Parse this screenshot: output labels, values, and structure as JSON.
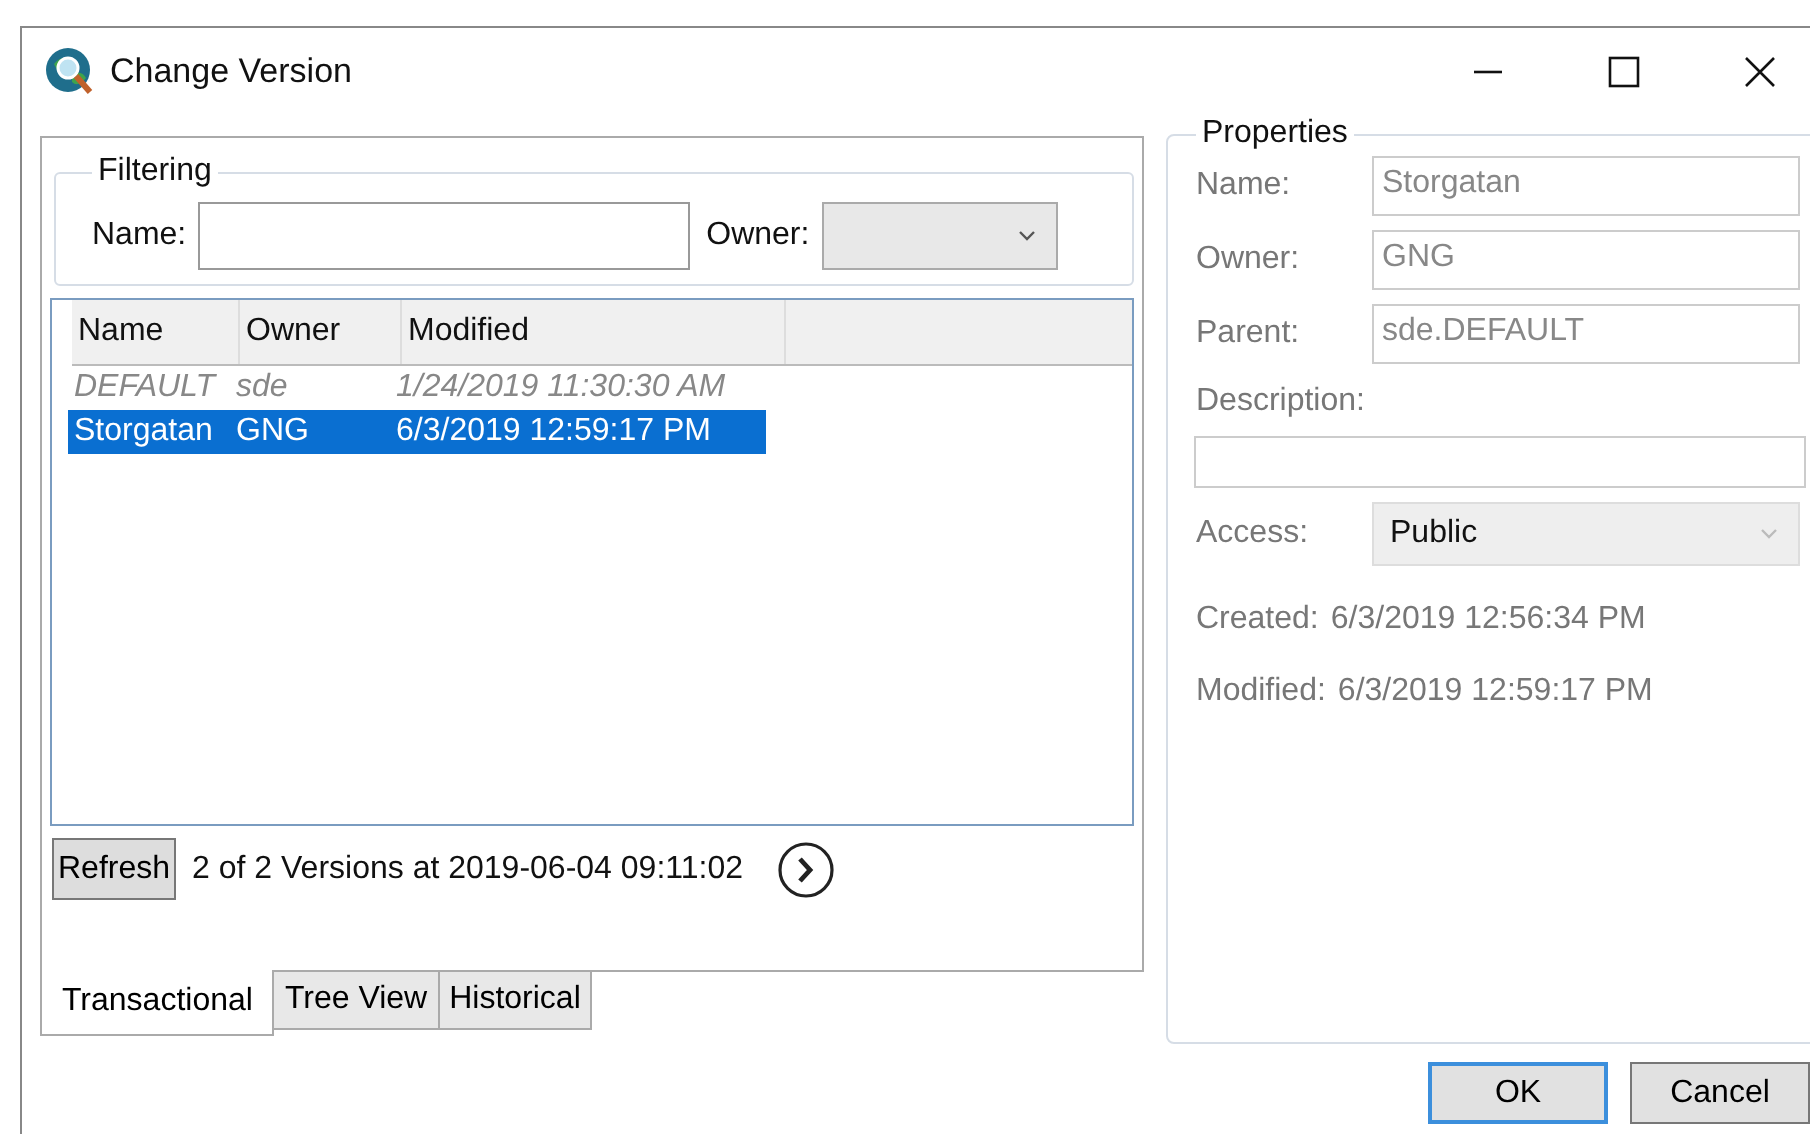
{
  "window": {
    "title": "Change Version"
  },
  "filtering": {
    "legend": "Filtering",
    "name_label": "Name:",
    "owner_label": "Owner:"
  },
  "table": {
    "columns": [
      "Name",
      "Owner",
      "Modified"
    ],
    "rows": [
      {
        "cells": [
          "DEFAULT",
          "sde",
          "1/24/2019 11:30:30 AM"
        ],
        "disabled": true,
        "selected": false
      },
      {
        "cells": [
          "Storgatan",
          "GNG",
          "6/3/2019 12:59:17 PM"
        ],
        "disabled": false,
        "selected": true
      }
    ]
  },
  "refresh_button": "Refresh",
  "status": "2 of 2 Versions at 2019-06-04 09:11:02",
  "tabs": [
    {
      "label": "Transactional",
      "selected": true
    },
    {
      "label": "Tree View",
      "selected": false
    },
    {
      "label": "Historical",
      "selected": false
    }
  ],
  "properties": {
    "legend": "Properties",
    "fields": [
      {
        "label": "Name:",
        "value": "Storgatan"
      },
      {
        "label": "Owner:",
        "value": "GNG"
      },
      {
        "label": "Parent:",
        "value": "sde.DEFAULT"
      }
    ],
    "description_label": "Description:",
    "access_label": "Access:",
    "access_value": "Public",
    "info": [
      {
        "label": "Created:",
        "value": "6/3/2019 12:56:34 PM"
      },
      {
        "label": "Modified:",
        "value": "6/3/2019 12:59:17 PM"
      }
    ]
  },
  "buttons": [
    "OK",
    "Cancel"
  ]
}
